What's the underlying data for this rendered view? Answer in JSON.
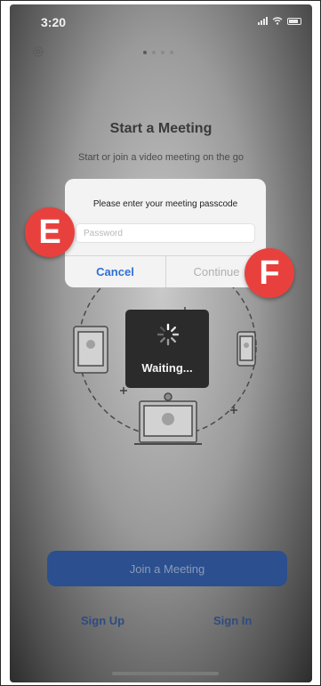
{
  "status_bar": {
    "time": "3:20"
  },
  "header": {
    "settings_icon": "gear-icon",
    "pages": 4,
    "active_page": 1
  },
  "main": {
    "title": "Start a Meeting",
    "subtitle": "Start or join a video meeting on the go"
  },
  "dialog": {
    "message": "Please enter your meeting passcode",
    "input_placeholder": "Password",
    "cancel_label": "Cancel",
    "continue_label": "Continue"
  },
  "loading": {
    "label": "Waiting..."
  },
  "markers": {
    "e": "E",
    "f": "F"
  },
  "footer": {
    "join_label": "Join a Meeting",
    "sign_up_label": "Sign Up",
    "sign_in_label": "Sign In"
  },
  "colors": {
    "accent": "#2f6fd6",
    "marker": "#e8413d",
    "join_button": "#2b4f8f"
  }
}
